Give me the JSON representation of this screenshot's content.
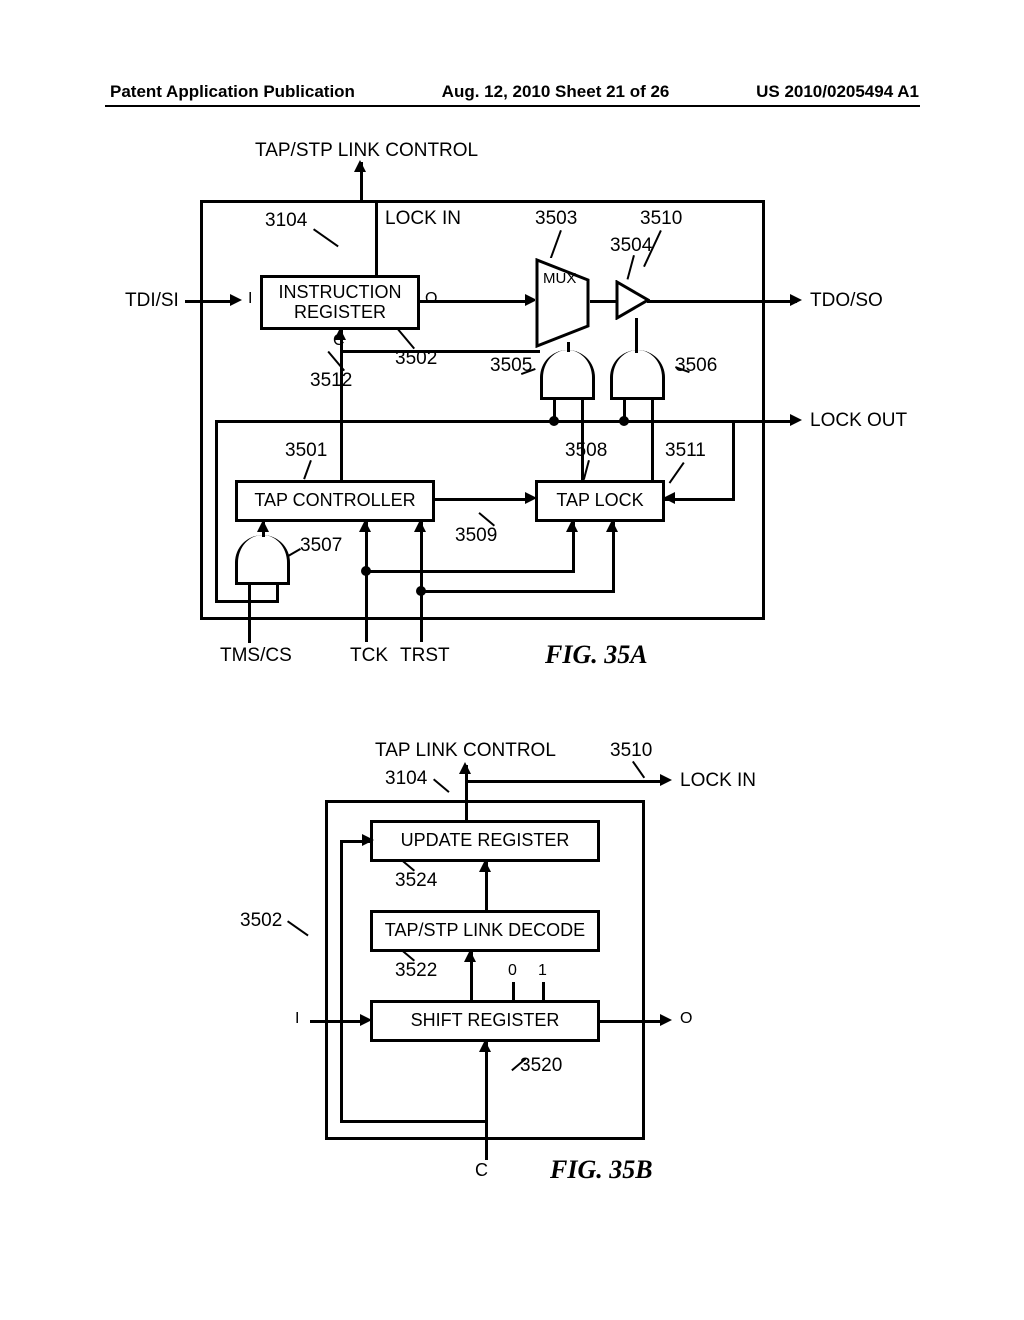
{
  "header": {
    "left": "Patent Application Publication",
    "center": "Aug. 12, 2010  Sheet 21 of 26",
    "right": "US 2010/0205494 A1"
  },
  "figA": {
    "title": "FIG. 35A",
    "top_signal": "TAP/STP LINK CONTROL",
    "lock_in": "LOCK IN",
    "tdi_si": "TDI/SI",
    "tdo_so": "TDO/SO",
    "lock_out": "LOCK OUT",
    "instruction_register": "INSTRUCTION\nREGISTER",
    "mux": "MUX",
    "tap_controller": "TAP CONTROLLER",
    "tap_lock": "TAP LOCK",
    "tms_cs": "TMS/CS",
    "tck": "TCK",
    "trst": "TRST",
    "ref_3104": "3104",
    "ref_3501": "3501",
    "ref_3502": "3502",
    "ref_3503": "3503",
    "ref_3504": "3504",
    "ref_3505": "3505",
    "ref_3506": "3506",
    "ref_3507": "3507",
    "ref_3508": "3508",
    "ref_3509": "3509",
    "ref_3510": "3510",
    "ref_3511": "3511",
    "ref_3512": "3512",
    "port_I": "I",
    "port_O": "O",
    "port_C": "C"
  },
  "figB": {
    "title": "FIG. 35B",
    "top_signal": "TAP LINK CONTROL",
    "lock_in": "LOCK IN",
    "update_register": "UPDATE REGISTER",
    "tap_stp_link_decode": "TAP/STP LINK DECODE",
    "shift_register": "SHIFT REGISTER",
    "ref_3104": "3104",
    "ref_3502": "3502",
    "ref_3510": "3510",
    "ref_3520": "3520",
    "ref_3522": "3522",
    "ref_3524": "3524",
    "port_I": "I",
    "port_O": "O",
    "port_C": "C",
    "bit0": "0",
    "bit1": "1"
  }
}
